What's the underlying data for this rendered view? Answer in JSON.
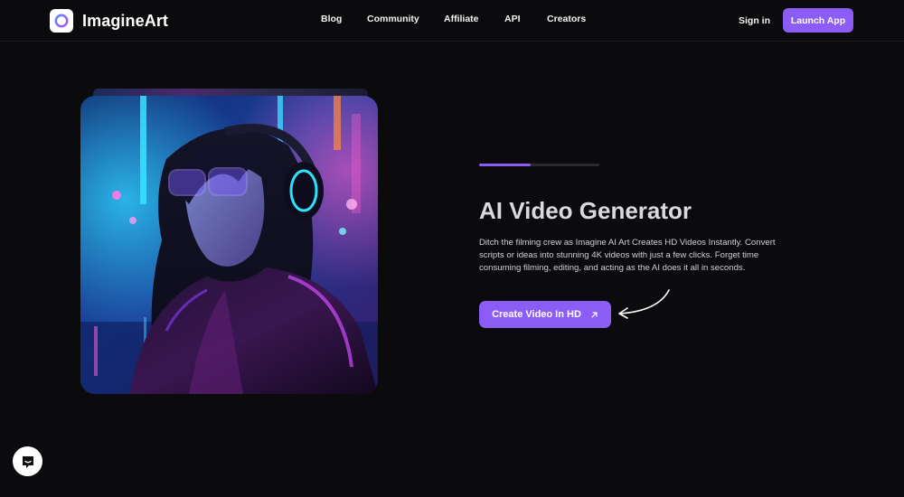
{
  "brand": {
    "name": "ImagineArt",
    "accent": "#8b5cf6"
  },
  "nav": {
    "links": [
      {
        "label": "Blog"
      },
      {
        "label": "Community"
      },
      {
        "label": "Affiliate"
      },
      {
        "label": "API"
      },
      {
        "label": "Creators"
      }
    ],
    "signin_label": "Sign in",
    "launch_label": "Launch App"
  },
  "hero": {
    "progress": 0.43,
    "title": "AI Video Generator",
    "description": "Ditch the filming crew as Imagine AI Art Creates HD Videos Instantly. Convert scripts or ideas into stunning 4K videos with just a few clicks. Forget time consuming filming, editing, and acting as the AI does it all in seconds.",
    "cta_label": "Create Video In HD",
    "cta_icon": "arrow-up-right-icon",
    "image_subject": "neon-headphones-portrait-image"
  },
  "chat": {
    "icon": "chat-bubble-icon"
  }
}
